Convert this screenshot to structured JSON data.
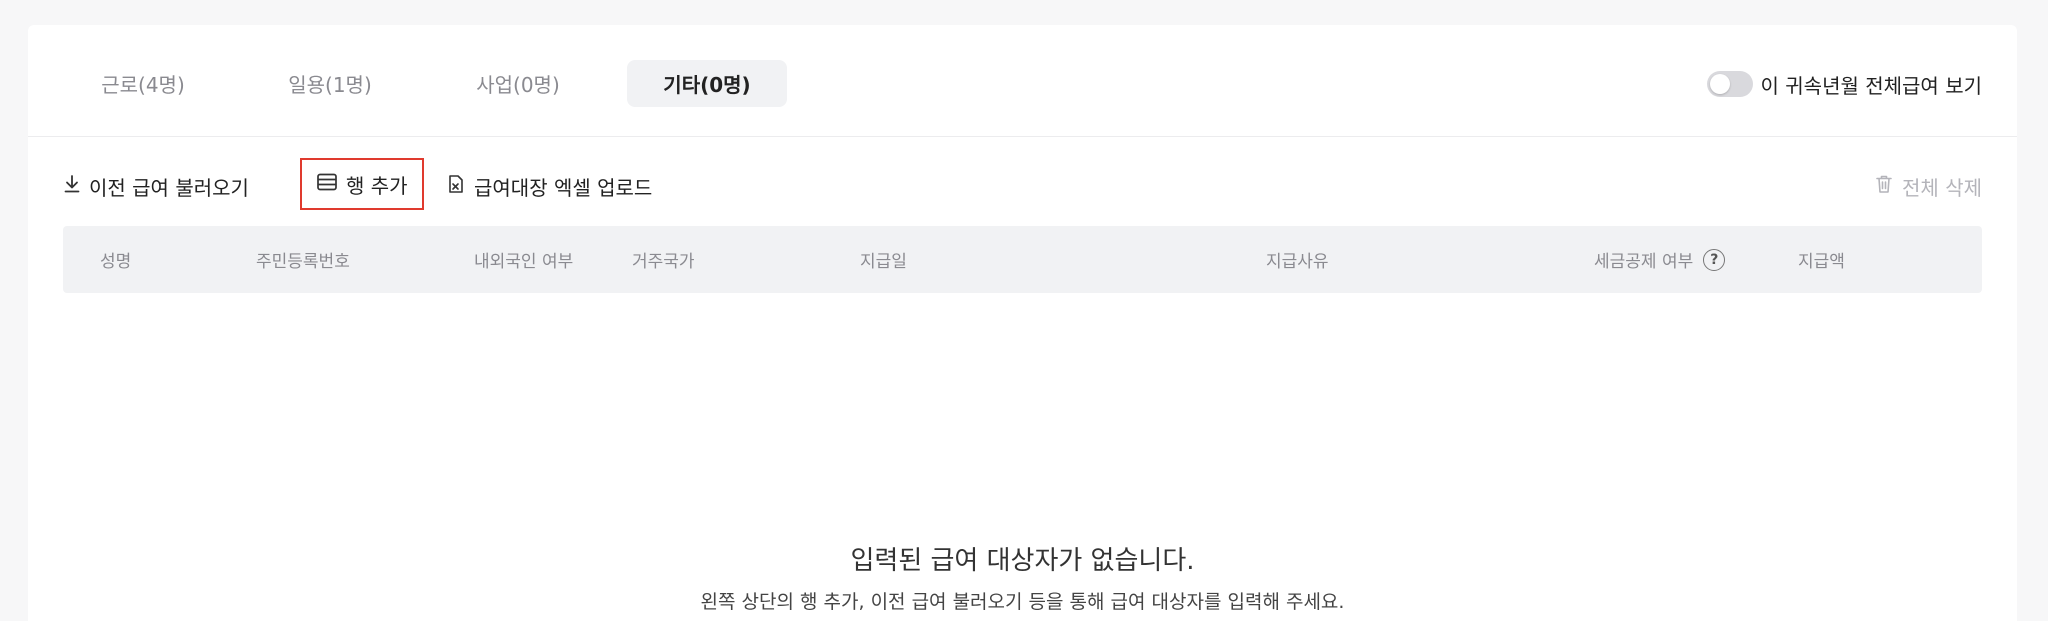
{
  "tabs": [
    {
      "label": "근로(4명)"
    },
    {
      "label": "일용(1명)"
    },
    {
      "label": "사업(0명)"
    },
    {
      "label": "기타(0명)"
    }
  ],
  "active_tab": "기타(0명)",
  "toggle": {
    "label": "이 귀속년월 전체급여 보기",
    "on": false
  },
  "toolbar": {
    "load_previous_label": "이전 급여 불러오기",
    "add_row_label": "행 추가",
    "excel_upload_label": "급여대장 엑셀 업로드",
    "delete_all_label": "전체 삭제"
  },
  "table": {
    "columns": [
      "성명",
      "주민등록번호",
      "내외국인 여부",
      "거주국가",
      "지급일",
      "지급사유",
      "세금공제 여부",
      "지급액"
    ],
    "help_icon_glyph": "?"
  },
  "empty_state": {
    "title": "입력된 급여 대상자가 없습니다.",
    "subtitle": "왼쪽 상단의 행 추가, 이전 급여 불러오기 등을 통해 급여 대상자를 입력해 주세요."
  },
  "colors": {
    "highlight_border": "#e03a2e",
    "active_tab_bg": "#f1f2f4",
    "header_bg": "#f1f2f4"
  },
  "icons": [
    "download-icon",
    "table-rows-icon",
    "excel-file-icon",
    "trash-icon",
    "help-circle-icon"
  ]
}
